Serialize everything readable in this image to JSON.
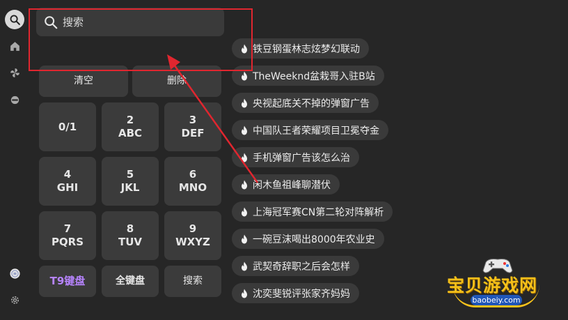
{
  "search": {
    "placeholder": "搜索"
  },
  "keyboard": {
    "clear_label": "清空",
    "delete_label": "删除",
    "keys": [
      {
        "num": "",
        "letters": "0/1"
      },
      {
        "num": "2",
        "letters": "ABC"
      },
      {
        "num": "3",
        "letters": "DEF"
      },
      {
        "num": "4",
        "letters": "GHI"
      },
      {
        "num": "5",
        "letters": "JKL"
      },
      {
        "num": "6",
        "letters": "MNO"
      },
      {
        "num": "7",
        "letters": "PQRS"
      },
      {
        "num": "8",
        "letters": "TUV"
      },
      {
        "num": "9",
        "letters": "WXYZ"
      }
    ],
    "t9_label": "T9键盘",
    "full_label": "全键盘",
    "search_label": "搜索"
  },
  "hot_searches": [
    "铁豆钢蛋林志炫梦幻联动",
    "TheWeeknd盆栽哥入驻B站",
    "央视起底关不掉的弹窗广告",
    "中国队王者荣耀项目卫冕夺金",
    "手机弹窗广告该怎么治",
    "闲木鱼祖峰聊潜伏",
    "上海冠军赛CN第二轮对阵解析",
    "一碗豆沫喝出8000年农业史",
    "武契奇辞职之后会怎样",
    "沈奕斐锐评张家齐妈妈"
  ],
  "watermark": {
    "title": "宝贝游戏网",
    "url": "baobeiy.com"
  },
  "colors": {
    "accent": "#b784ff",
    "annotation": "#e0262f",
    "watermark": "#f4c01a"
  }
}
